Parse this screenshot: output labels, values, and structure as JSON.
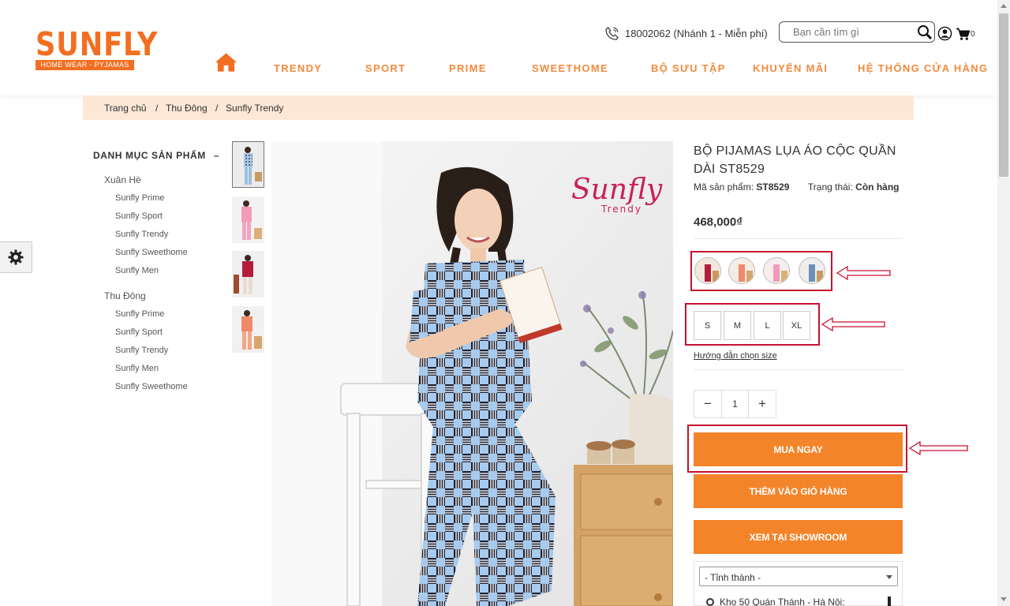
{
  "brand": {
    "name": "SUNFLY",
    "tagline": "HOME WEAR - PYJAMAS",
    "accent": "#f26f21"
  },
  "header": {
    "hotline": "18002062 (Nhánh 1 - Miễn phí)",
    "search_placeholder": "Bạn cần tìm gì",
    "cart_count": "0"
  },
  "nav": {
    "items": [
      {
        "label": "TRENDY"
      },
      {
        "label": "SPORT"
      },
      {
        "label": "PRIME"
      },
      {
        "label": "SWEETHOME"
      },
      {
        "label": "BỘ SƯU TẬP"
      },
      {
        "label": "KHUYẾN MÃI"
      },
      {
        "label": "HỆ THỐNG CỬA HÀNG"
      }
    ]
  },
  "breadcrumb": {
    "items": [
      "Trang chủ",
      "/",
      "Thu Đông",
      "/",
      "Sunfly Trendy"
    ]
  },
  "sidebar": {
    "title": "DANH MỤC SẢN PHẨM",
    "toggle": "–",
    "groups": [
      {
        "label": "Xuân Hè",
        "items": [
          "Sunfly Prime",
          "Sunfly Sport",
          "Sunfly Trendy",
          "Sunfly Sweethome",
          "Sunfly Men"
        ]
      },
      {
        "label": "Thu Đông",
        "items": [
          "Sunfly Prime",
          "Sunfly Sport",
          "Sunfly Trendy",
          "Sunfly Men",
          "Sunfly Sweethome"
        ]
      }
    ]
  },
  "image": {
    "brand_watermark": "Sunfly",
    "brand_watermark_sub": "Trendy"
  },
  "product": {
    "title": "BỘ PIJAMAS LỤA ÁO CỘC QUẦN DÀI ST8529",
    "sku_label": "Mã sản phẩm:",
    "sku": "ST8529",
    "status_label": "Trạng thái:",
    "status": "Còn hàng",
    "price": "468,000₫",
    "sizes": [
      "S",
      "M",
      "L",
      "XL"
    ],
    "size_guide": "Hướng dẫn chọn size",
    "quantity": "1",
    "qty_minus": "−",
    "qty_plus": "+",
    "buy_now": "MUA NGAY",
    "add_to_cart": "THÊM VÀO GIỎ HÀNG",
    "view_showroom": "XEM TẠI SHOWROOM",
    "province_placeholder": "- Tỉnh thành -",
    "store_item": "Kho 50 Quán Thánh - Hà Nội:"
  },
  "colors": {
    "highlight": "#c8102e",
    "button": "#f4842a",
    "nav": "#f28a3f",
    "breadcrumb_bg": "#fde7d6"
  }
}
